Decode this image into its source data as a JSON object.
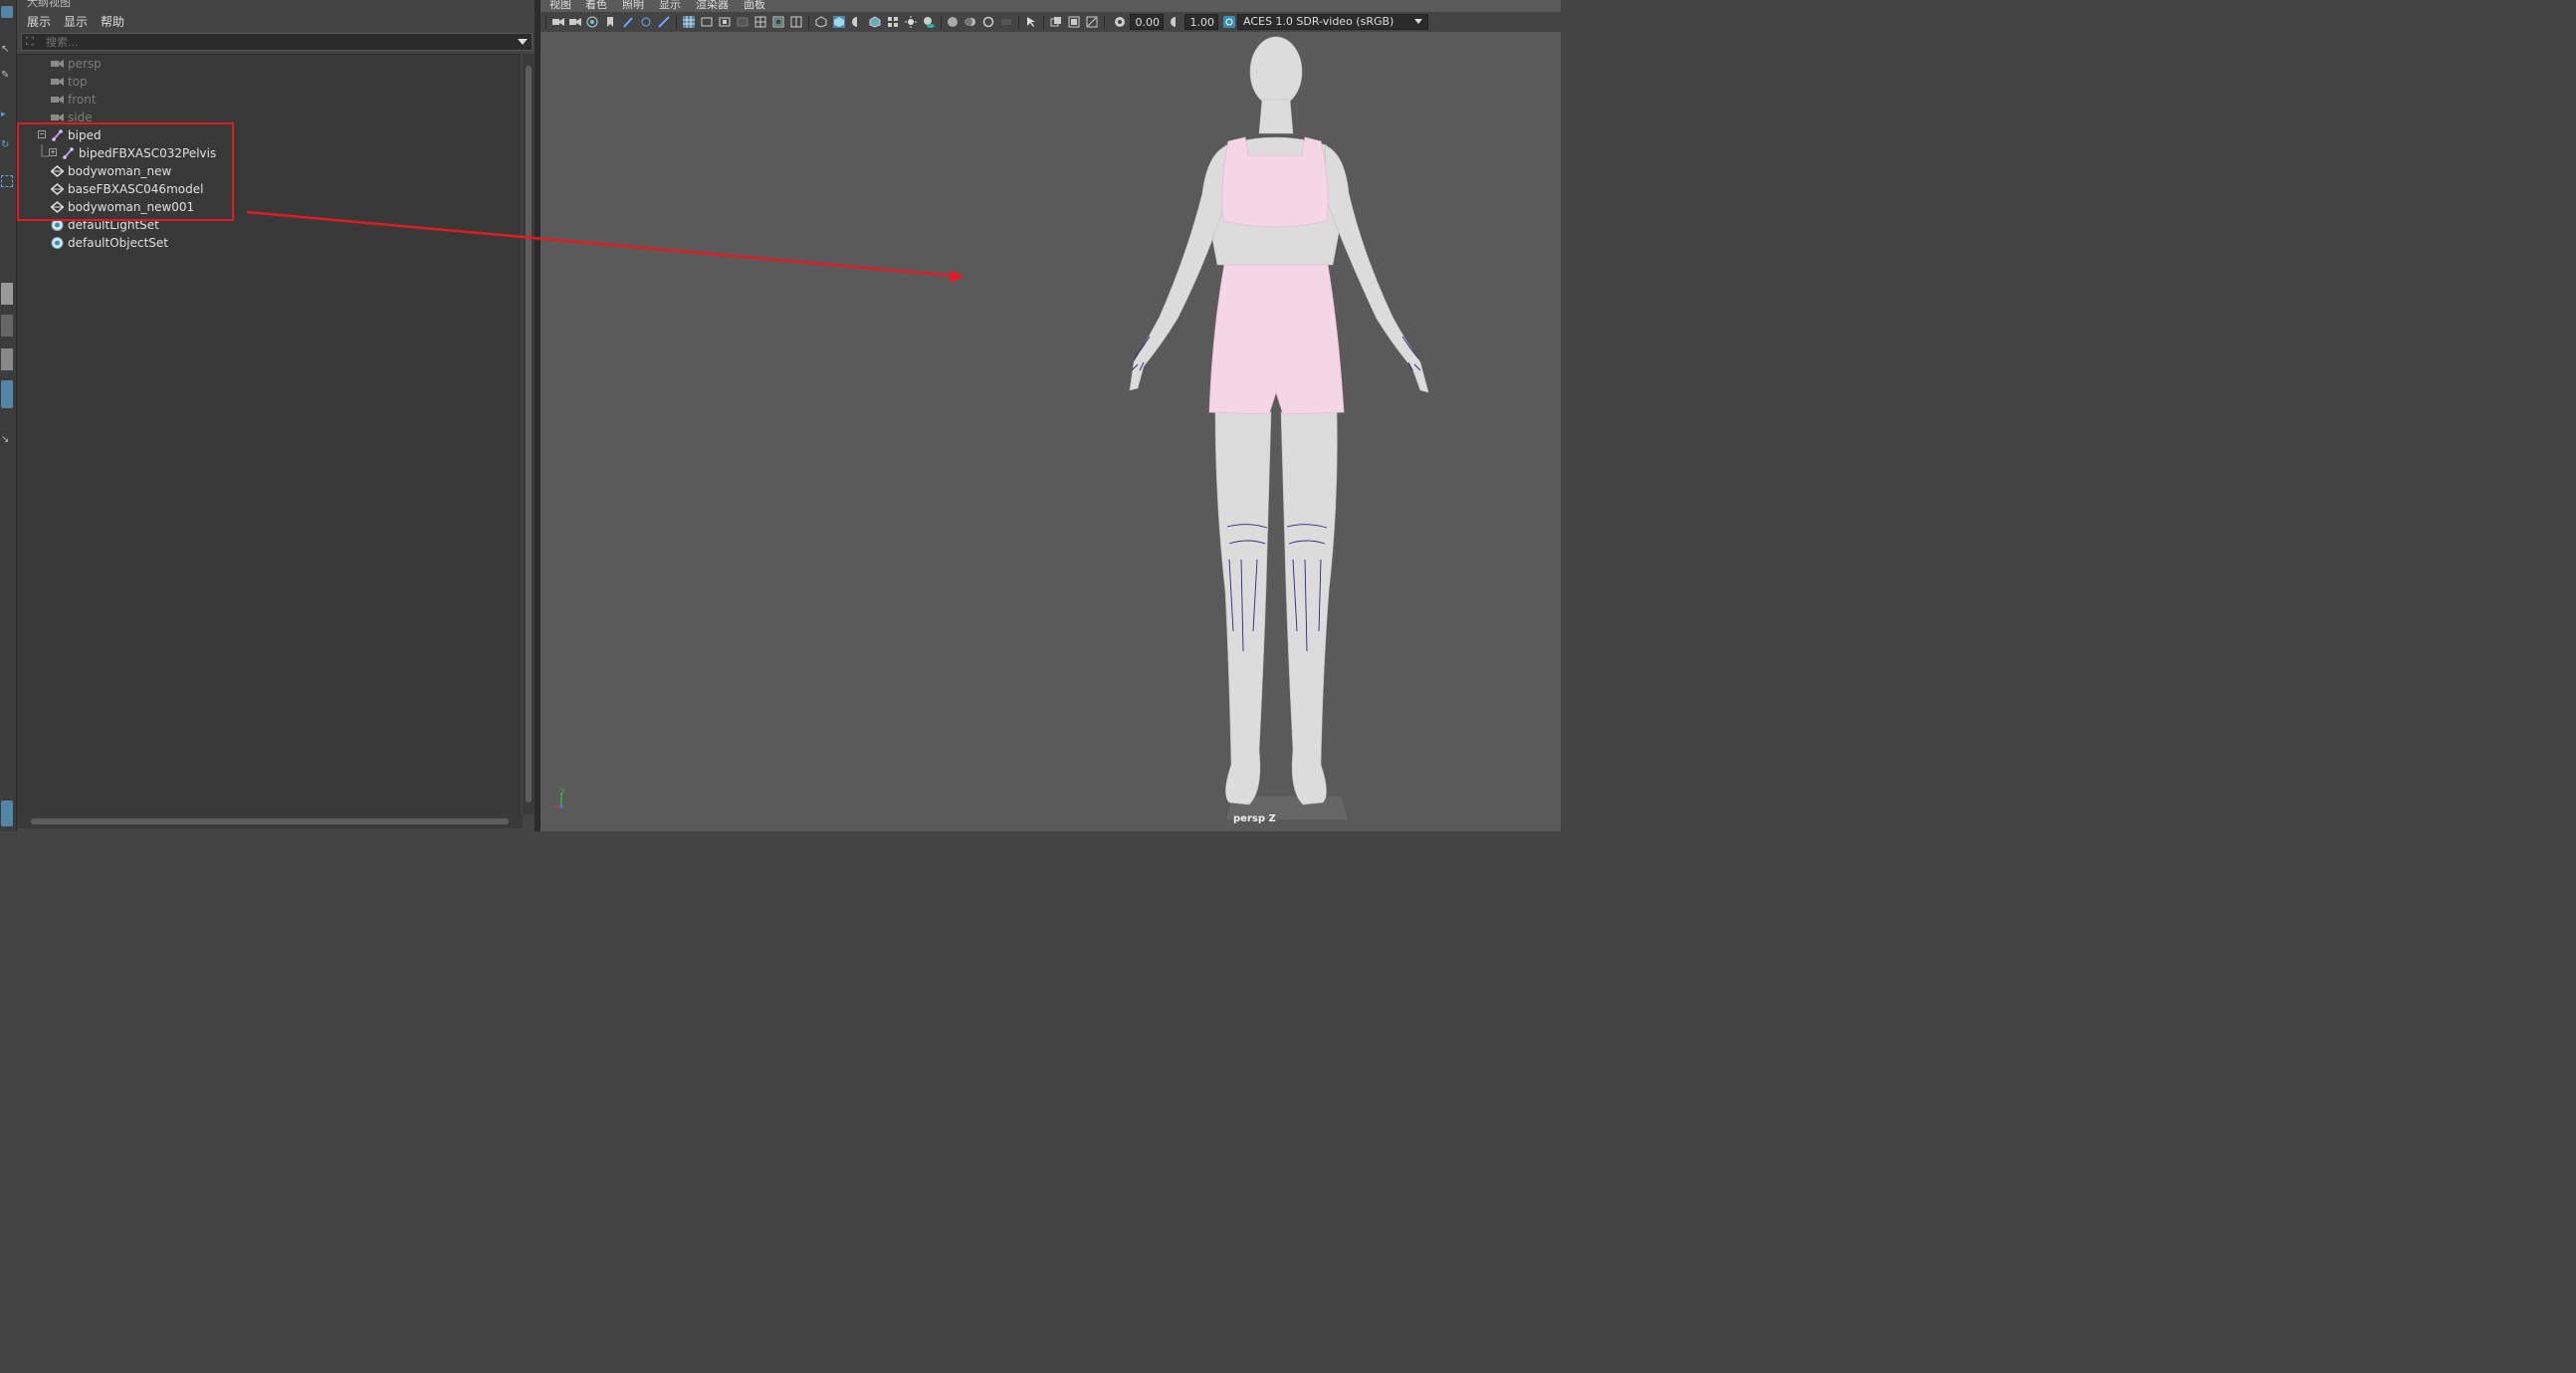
{
  "outliner": {
    "title": "大纲视图",
    "menu": [
      "展示",
      "显示",
      "帮助"
    ],
    "search_placeholder": "搜索...",
    "items": [
      {
        "label": "persp",
        "state": "dim",
        "icon": "camera-icon"
      },
      {
        "label": "top",
        "state": "dim",
        "icon": "camera-icon"
      },
      {
        "label": "front",
        "state": "dim",
        "icon": "camera-icon"
      },
      {
        "label": "side",
        "state": "dim",
        "icon": "camera-icon"
      },
      {
        "label": "biped",
        "state": "lit",
        "icon": "joint-icon",
        "expander": "−"
      },
      {
        "label": "bipedFBXASC032Pelvis",
        "state": "lit",
        "icon": "joint-icon",
        "expander": "+"
      },
      {
        "label": "bodywoman_new",
        "state": "lit",
        "icon": "mesh-icon"
      },
      {
        "label": "baseFBXASC046model",
        "state": "lit",
        "icon": "mesh-icon"
      },
      {
        "label": "bodywoman_new001",
        "state": "lit",
        "icon": "mesh-icon"
      },
      {
        "label": "defaultLightSet",
        "state": "lit",
        "icon": "set-icon"
      },
      {
        "label": "defaultObjectSet",
        "state": "lit",
        "icon": "set-icon"
      }
    ]
  },
  "viewport": {
    "menu": [
      "视图",
      "着色",
      "照明",
      "显示",
      "渲染器",
      "面板"
    ],
    "exposure": "0.00",
    "gamma": "1.00",
    "colorspace": "ACES 1.0 SDR-video (sRGB)",
    "camera_label": "persp Z",
    "axis_label": "y"
  },
  "colors": {
    "highlight": "#e01b24",
    "figure_skin": "#dcdcdc",
    "garment": "#f5d6e6"
  }
}
